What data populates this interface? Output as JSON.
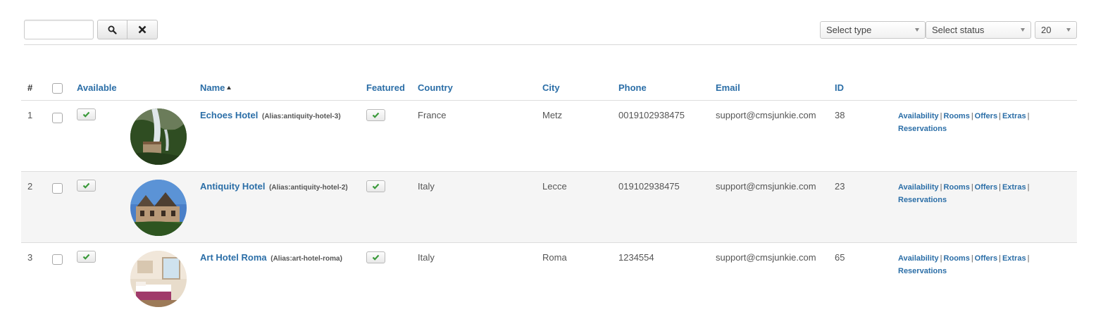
{
  "toolbar": {
    "search": {
      "value": "",
      "placeholder": ""
    },
    "search_button_icon": "search-icon",
    "clear_button_icon": "close-icon",
    "select_type": "Select type",
    "select_status": "Select status",
    "list_limit": "20"
  },
  "table": {
    "headers": {
      "num": "#",
      "available": "Available",
      "name": "Name",
      "featured": "Featured",
      "country": "Country",
      "city": "City",
      "phone": "Phone",
      "email": "Email",
      "id": "ID"
    },
    "rows": [
      {
        "num": "1",
        "name": "Echoes Hotel",
        "alias": "(Alias:antiquity-hotel-3)",
        "country": "France",
        "city": "Metz",
        "phone": "0019102938475",
        "email": "support@cmsjunkie.com",
        "id": "38",
        "image": "waterfall-landscape-thumbnail"
      },
      {
        "num": "2",
        "name": "Antiquity Hotel",
        "alias": "(Alias:antiquity-hotel-2)",
        "country": "Italy",
        "city": "Lecce",
        "phone": "019102938475",
        "email": "support@cmsjunkie.com",
        "id": "23",
        "image": "stone-villa-thumbnail"
      },
      {
        "num": "3",
        "name": "Art Hotel Roma",
        "alias": "(Alias:art-hotel-roma)",
        "country": "Italy",
        "city": "Roma",
        "phone": "1234554",
        "email": "support@cmsjunkie.com",
        "id": "65",
        "image": "hotel-room-thumbnail"
      }
    ],
    "actions": {
      "availability": "Availability",
      "rooms": "Rooms",
      "offers": "Offers",
      "extras": "Extras",
      "reservations": "Reservations",
      "separator": "|"
    }
  },
  "colors": {
    "link": "#2b6ea7",
    "check": "#3a9a3a",
    "alt_row": "#f5f5f5"
  }
}
